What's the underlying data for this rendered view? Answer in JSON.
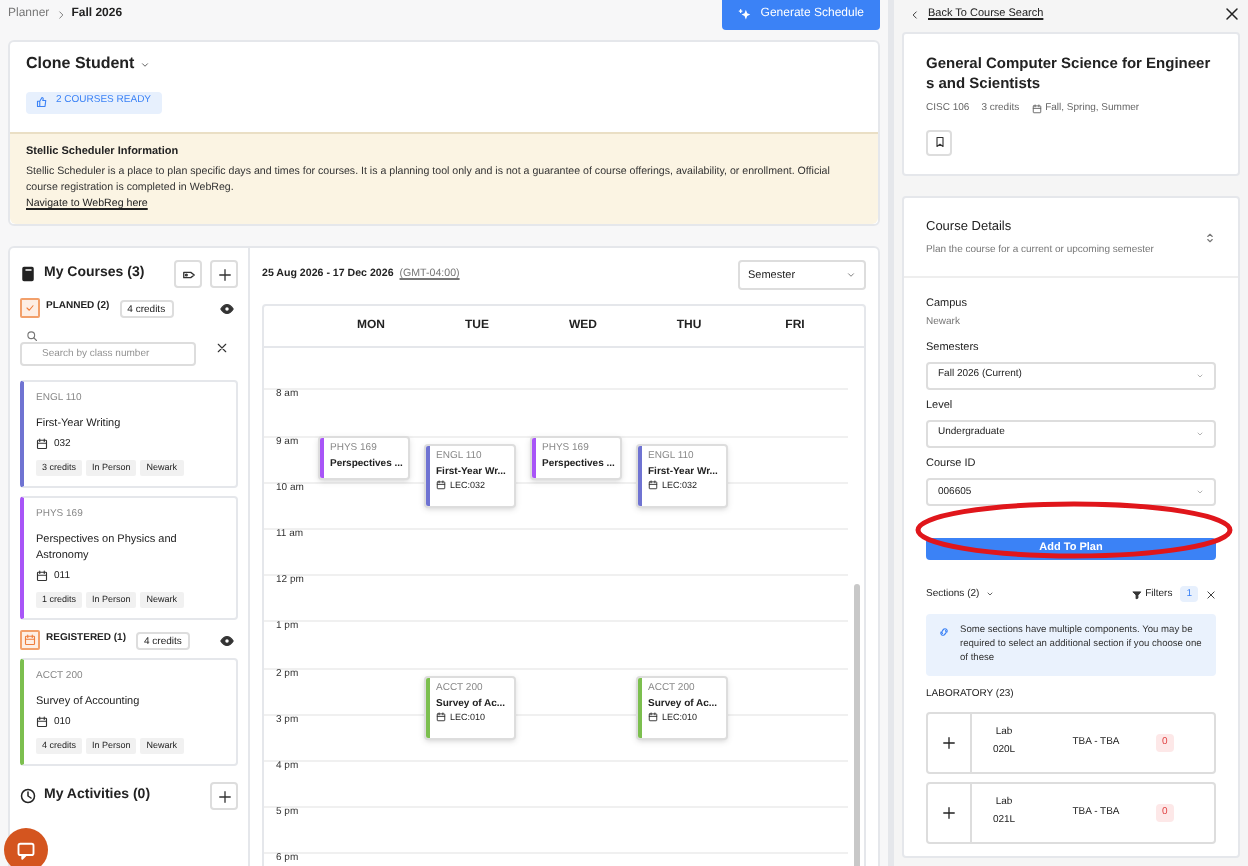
{
  "breadcrumb": {
    "parent": "Planner",
    "current": "Fall 2026"
  },
  "generate_button": "Generate Schedule",
  "student": {
    "name": "Clone Student",
    "badge": "2 COURSES READY"
  },
  "info": {
    "title": "Stellic Scheduler Information",
    "text": "Stellic Scheduler is a place to plan specific days and times for courses. It is a planning tool only and is not a guarantee of course offerings, availability, or enrollment. Official course registration is completed in WebReg.",
    "link": "Navigate to WebReg here"
  },
  "my_courses": {
    "title": "My Courses (3)",
    "search_placeholder": "Search by class number",
    "groups": [
      {
        "kind": "planned",
        "label": "PLANNED (2)",
        "credits": "4 credits",
        "visible": true,
        "courses": [
          {
            "code": "ENGL 110",
            "title": "First-Year Writing",
            "section": "032",
            "tags": [
              "3 credits",
              "In Person",
              "Newark"
            ],
            "color": "#6f73d2"
          },
          {
            "code": "PHYS 169",
            "title": "Perspectives on Physics and Astronomy",
            "section": "011",
            "tags": [
              "1 credits",
              "In Person",
              "Newark"
            ],
            "color": "#a855f7"
          }
        ]
      },
      {
        "kind": "registered",
        "label": "REGISTERED (1)",
        "credits": "4 credits",
        "visible": true,
        "courses": [
          {
            "code": "ACCT 200",
            "title": "Survey of Accounting",
            "section": "010",
            "tags": [
              "4 credits",
              "In Person",
              "Newark"
            ],
            "color": "#7cbf4f"
          }
        ]
      }
    ]
  },
  "activities": {
    "title": "My Activities (0)"
  },
  "calendar": {
    "range": "25 Aug 2026 - 17 Dec 2026",
    "timezone": "(GMT-04:00)",
    "view": "Semester",
    "days": [
      "MON",
      "TUE",
      "WED",
      "THU",
      "FRI"
    ],
    "hours": [
      {
        "label": "8 am"
      },
      {
        "label": "9 am",
        "cells": [
          {
            "code": "PHYS 169",
            "title": "Perspectives ...",
            "color": "#a855f7"
          },
          {
            "code": "ENGL 110",
            "title": "First-Year Wr...",
            "section": "LEC:032",
            "color": "#6f73d2"
          },
          {
            "code": "PHYS 169",
            "title": "Perspectives ...",
            "color": "#a855f7"
          },
          {
            "code": "ENGL 110",
            "title": "First-Year Wr...",
            "section": "LEC:032",
            "color": "#6f73d2"
          },
          null
        ]
      },
      {
        "label": "10 am"
      },
      {
        "label": "11 am"
      },
      {
        "label": "12 pm"
      },
      {
        "label": "1 pm"
      },
      {
        "label": "2 pm",
        "cells": [
          null,
          {
            "code": "ACCT 200",
            "title": "Survey of Ac...",
            "section": "LEC:010",
            "color": "#7cbf4f"
          },
          null,
          {
            "code": "ACCT 200",
            "title": "Survey of Ac...",
            "section": "LEC:010",
            "color": "#7cbf4f"
          },
          null
        ]
      },
      {
        "label": "3 pm"
      },
      {
        "label": "4 pm"
      },
      {
        "label": "5 pm"
      },
      {
        "label": "6 pm"
      }
    ]
  },
  "panel": {
    "back": "Back To Course Search",
    "course": {
      "title": "General Computer Science for Engineers and Scientists",
      "code": "CISC 106",
      "credits": "3 credits",
      "terms": "Fall, Spring, Summer"
    },
    "details": {
      "title": "Course Details",
      "subtitle": "Plan the course for a current or upcoming semester",
      "campus_label": "Campus",
      "campus": "Newark",
      "fields": [
        {
          "label": "Semesters",
          "value": "Fall 2026 (Current)"
        },
        {
          "label": "Level",
          "value": "Undergraduate"
        },
        {
          "label": "Course ID",
          "value": "006605"
        }
      ],
      "add_button": {
        "label": "Add To Plan",
        "circled": true
      }
    },
    "sections": {
      "label": "Sections (2)",
      "filters": "Filters",
      "filter_count": "1",
      "notice": "Some sections have multiple components. You may be required to select an additional section if you choose one of these",
      "group": "LABORATORY (23)",
      "rows": [
        {
          "type": "Lab",
          "number": "020L",
          "time": "TBA - TBA",
          "seats": "0"
        },
        {
          "type": "Lab",
          "number": "021L",
          "time": "TBA - TBA",
          "seats": "0"
        }
      ]
    }
  }
}
